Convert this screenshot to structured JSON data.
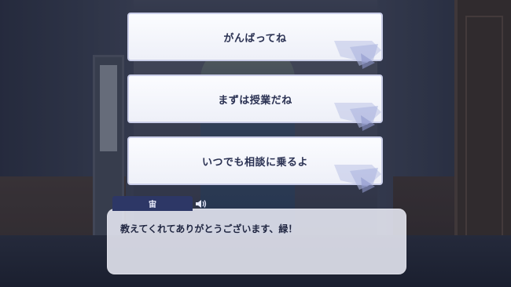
{
  "choices": [
    {
      "label": "がんばってね"
    },
    {
      "label": "まずは授業だね"
    },
    {
      "label": "いつでも相談に乗るよ"
    }
  ],
  "dialog": {
    "speaker": "宙",
    "message": "教えてくれてありがとうございます、緑！",
    "voice_icon": "speaker-icon"
  },
  "colors": {
    "choice_background": "#f4f6fc",
    "choice_border": "#c9cde8",
    "choice_text": "#2a3152",
    "nameplate": "#2d3766",
    "dialog_background": "#eceef8"
  }
}
